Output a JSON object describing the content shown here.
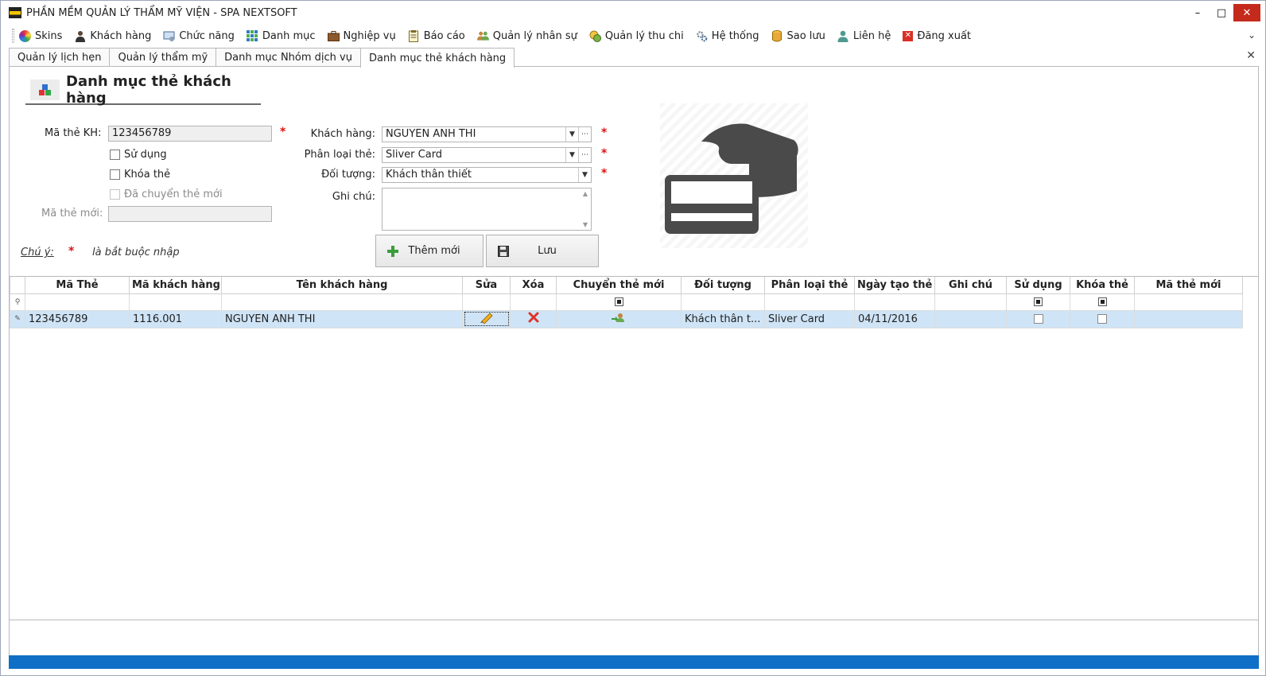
{
  "window": {
    "title": "PHẦN MỀM QUẢN LÝ THẨM MỸ VIỆN - SPA NEXTSOFT"
  },
  "menu": {
    "items": [
      {
        "label": "Skins",
        "icon": "skins-icon"
      },
      {
        "label": "Khách hàng",
        "icon": "customer-icon"
      },
      {
        "label": "Chức năng",
        "icon": "function-icon"
      },
      {
        "label": "Danh mục",
        "icon": "catalog-icon"
      },
      {
        "label": "Nghiệp vụ",
        "icon": "briefcase-icon"
      },
      {
        "label": "Báo cáo",
        "icon": "report-icon"
      },
      {
        "label": "Quản lý nhân sự",
        "icon": "staff-icon"
      },
      {
        "label": "Quản lý thu chi",
        "icon": "money-icon"
      },
      {
        "label": "Hệ thống",
        "icon": "system-gear-icon"
      },
      {
        "label": "Sao lưu",
        "icon": "backup-icon"
      },
      {
        "label": "Liên hệ",
        "icon": "contact-icon"
      },
      {
        "label": "Đăng xuất",
        "icon": "logout-icon"
      }
    ]
  },
  "tabs": [
    {
      "label": "Quản lý lịch hẹn"
    },
    {
      "label": "Quản lý thẩm mỹ"
    },
    {
      "label": "Danh mục Nhóm dịch vụ"
    },
    {
      "label": "Danh mục thẻ khách hàng",
      "active": true
    }
  ],
  "page": {
    "heading": "Danh mục thẻ khách hàng"
  },
  "form": {
    "card_code_label": "Mã thẻ KH:",
    "card_code_value": "123456789",
    "in_use_label": "Sử dụng",
    "locked_label": "Khóa thẻ",
    "transferred_label": "Đã chuyển thẻ mới",
    "new_card_label": "Mã thẻ mới:",
    "new_card_value": "",
    "customer_label": "Khách hàng:",
    "customer_value": "NGUYEN ANH THI",
    "card_type_label": "Phân loại thẻ:",
    "card_type_value": "Sliver Card",
    "target_label": "Đối tượng:",
    "target_value": "Khách thân thiết",
    "note_label": "Ghi chú:",
    "note_value": "",
    "required_mark": "*",
    "notice_title": "Chú ý:",
    "notice_text": "là bắt buộc nhập",
    "add_button": "Thêm mới",
    "save_button": "Lưu"
  },
  "grid": {
    "columns": [
      "Mã Thẻ",
      "Mã khách hàng",
      "Tên khách hàng",
      "Sửa",
      "Xóa",
      "Chuyển thẻ mới",
      "Đối tượng",
      "Phân loại thẻ",
      "Ngày tạo thẻ",
      "Ghi chú",
      "Sử dụng",
      "Khóa thẻ",
      "Mã thẻ mới"
    ],
    "rows": [
      {
        "card_code": "123456789",
        "customer_code": "1116.001",
        "customer_name": "NGUYEN ANH THI",
        "target": "Khách thân t...",
        "card_type": "Sliver Card",
        "created": "04/11/2016",
        "note": "",
        "new_card": ""
      }
    ]
  },
  "colors": {
    "accent": "#0f6fc6",
    "required": "#e01010",
    "selected_row": "#cfe4f6"
  }
}
